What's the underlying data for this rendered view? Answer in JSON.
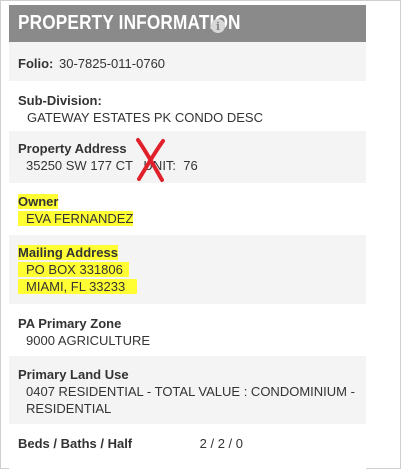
{
  "header": {
    "title": "PROPERTY INFORMATION",
    "info_icon": "info-icon"
  },
  "folio": {
    "label": "Folio:",
    "value": "30-7825-011-0760"
  },
  "subdivision": {
    "label": "Sub-Division:",
    "value": "GATEWAY ESTATES PK CONDO DESC"
  },
  "property_address": {
    "label": "Property Address",
    "value": "35250 SW 177 CT   UNIT:  76"
  },
  "owner": {
    "label": "Owner",
    "value": "EVA FERNANDEZ"
  },
  "mailing_address": {
    "label": "Mailing Address",
    "line1": "PO BOX 331806",
    "line2": "MIAMI, FL 33233"
  },
  "pa_zone": {
    "label": "PA Primary Zone",
    "value": "9000 AGRICULTURE"
  },
  "land_use": {
    "label": "Primary Land Use",
    "line1": "0407 RESIDENTIAL - TOTAL VALUE : CONDOMINIUM -",
    "line2": "RESIDENTIAL"
  },
  "beds": {
    "label": "Beds / Baths / Half",
    "value": "2 / 2 / 0"
  },
  "colors": {
    "header_bg": "#8a8a8a",
    "highlight": "#ffff33",
    "annotation_x": "#e0202a",
    "alt_row": "#f4f4f4"
  }
}
